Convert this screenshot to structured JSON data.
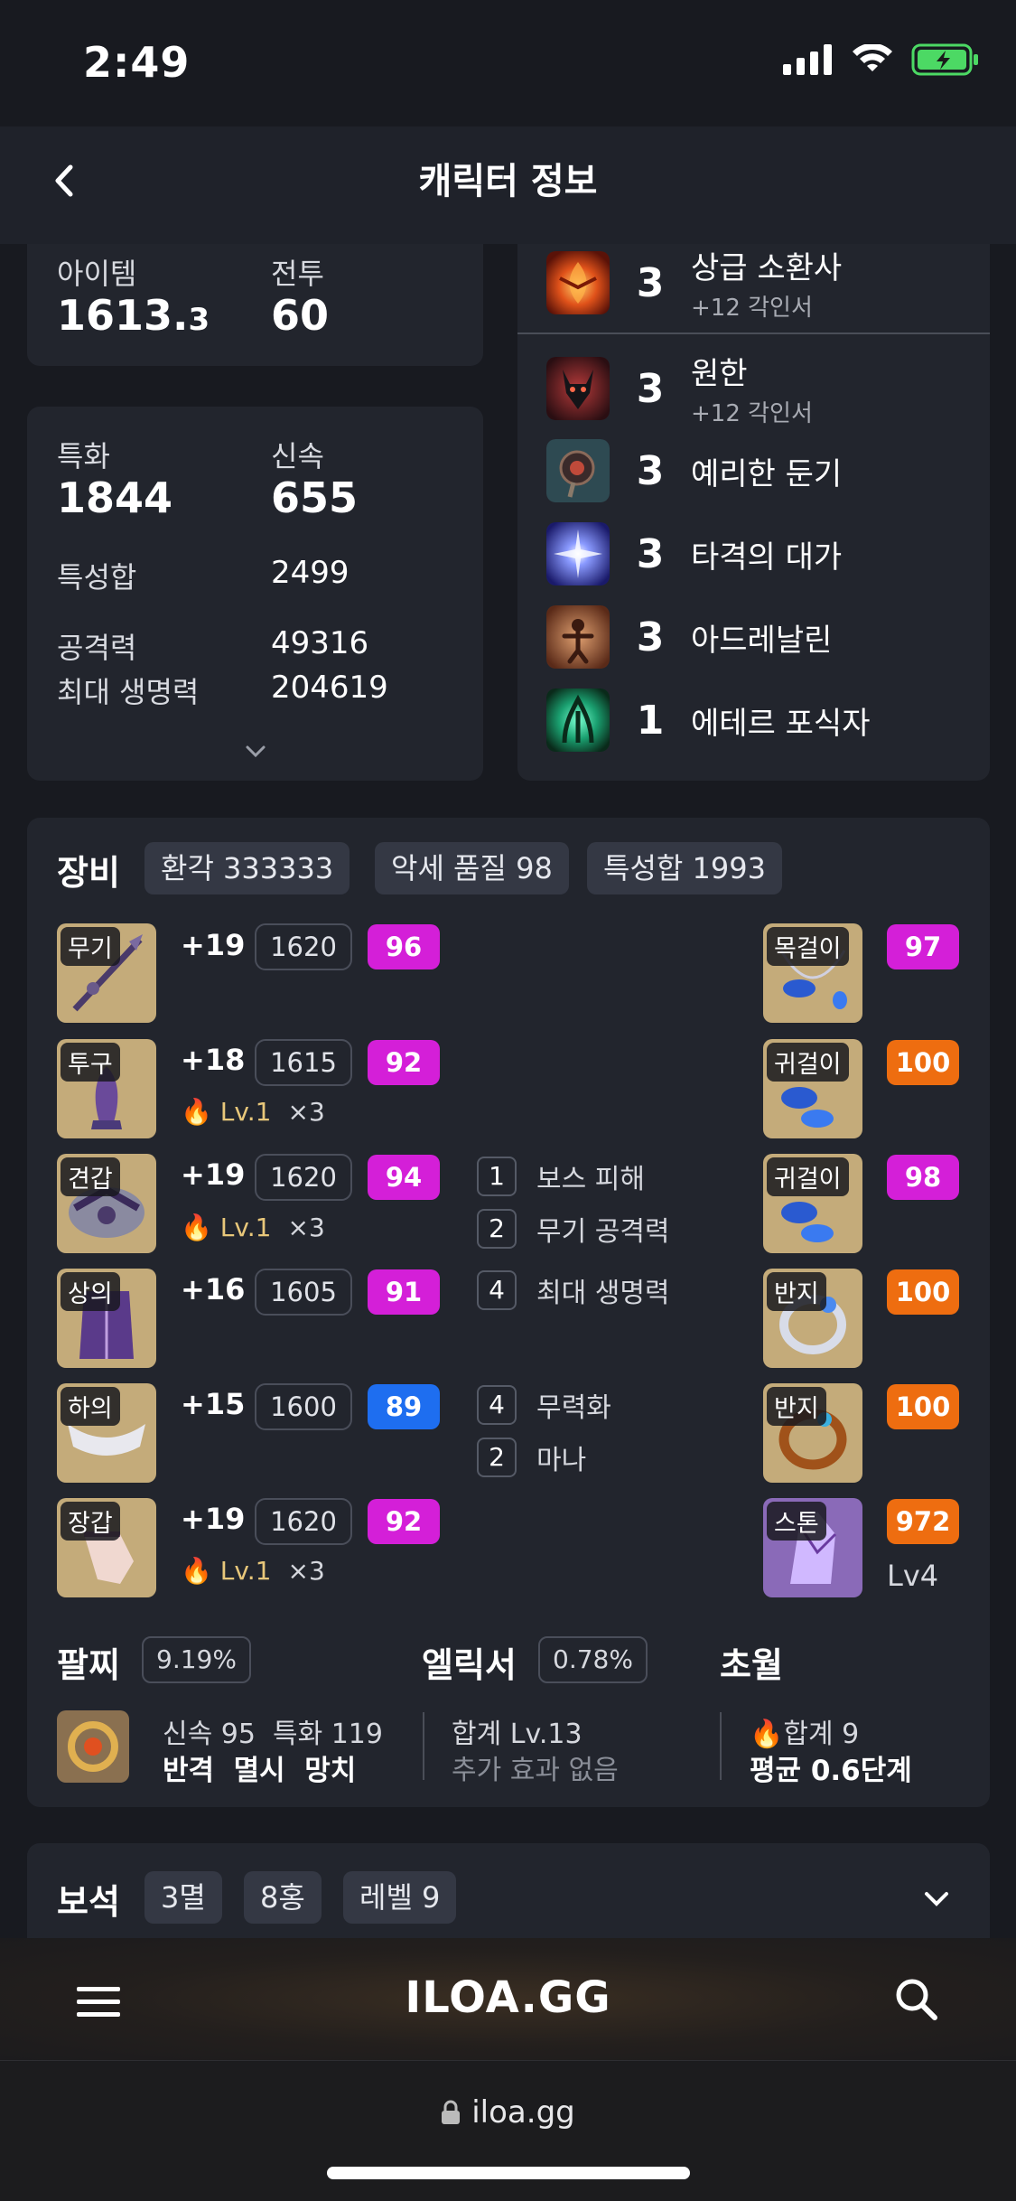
{
  "status": {
    "time": "2:49"
  },
  "header": {
    "title": "캐릭터 정보"
  },
  "stats_top": {
    "item_label": "아이템",
    "item_value": "1613.",
    "item_value_small": "3",
    "combat_label": "전투",
    "combat_value": "60"
  },
  "stats_main": {
    "crit_label": "특화",
    "crit_value": "1844",
    "swift_label": "신속",
    "swift_value": "655",
    "total_label": "특성합",
    "total_value": "2499",
    "atk_label": "공격력",
    "atk_value": "49316",
    "hp_label": "최대 생명력",
    "hp_value": "204619"
  },
  "engravings": [
    {
      "level": "3",
      "name": "상급 소환사",
      "sub": "+12 각인서",
      "icon": "phoenix-icon"
    },
    {
      "level": "3",
      "name": "원한",
      "sub": "+12 각인서",
      "icon": "demon-icon"
    },
    {
      "level": "3",
      "name": "예리한 둔기",
      "sub": "",
      "icon": "mace-icon"
    },
    {
      "level": "3",
      "name": "타격의 대가",
      "sub": "",
      "icon": "lightning-icon"
    },
    {
      "level": "3",
      "name": "아드레날린",
      "sub": "",
      "icon": "adrenaline-icon"
    },
    {
      "level": "1",
      "name": "에테르 포식자",
      "sub": "",
      "icon": "ether-icon"
    }
  ],
  "equipment": {
    "title": "장비",
    "chips": [
      "환각 333333",
      "악세 품질 98",
      "특성합 1993"
    ],
    "left": [
      {
        "slot": "무기",
        "plus": "+19",
        "ilvl": "1620",
        "quality": "96",
        "qclass": "q-mag",
        "lv": "",
        "x": ""
      },
      {
        "slot": "투구",
        "plus": "+18",
        "ilvl": "1615",
        "quality": "92",
        "qclass": "q-mag",
        "lv": "Lv.1",
        "x": "×3"
      },
      {
        "slot": "견갑",
        "plus": "+19",
        "ilvl": "1620",
        "quality": "94",
        "qclass": "q-mag",
        "lv": "Lv.1",
        "x": "×3"
      },
      {
        "slot": "상의",
        "plus": "+16",
        "ilvl": "1605",
        "quality": "91",
        "qclass": "q-mag",
        "lv": "",
        "x": ""
      },
      {
        "slot": "하의",
        "plus": "+15",
        "ilvl": "1600",
        "quality": "89",
        "qclass": "q-blu",
        "lv": "",
        "x": ""
      },
      {
        "slot": "장갑",
        "plus": "+19",
        "ilvl": "1620",
        "quality": "92",
        "qclass": "q-mag",
        "lv": "Lv.1",
        "x": "×3"
      }
    ],
    "effects": [
      {
        "num": "1",
        "text": "보스 피해"
      },
      {
        "num": "2",
        "text": "무기 공격력"
      },
      {
        "num": "4",
        "text": "최대 생명력"
      },
      {
        "num": "4",
        "text": "무력화"
      },
      {
        "num": "2",
        "text": "마나"
      }
    ],
    "right": [
      {
        "slot": "목걸이",
        "quality": "97",
        "qclass": "q-mag"
      },
      {
        "slot": "귀걸이",
        "quality": "100",
        "qclass": "q-org"
      },
      {
        "slot": "귀걸이",
        "quality": "98",
        "qclass": "q-mag"
      },
      {
        "slot": "반지",
        "quality": "100",
        "qclass": "q-org"
      },
      {
        "slot": "반지",
        "quality": "100",
        "qclass": "q-org"
      },
      {
        "slot": "스톤",
        "quality": "972",
        "qclass": "q-org"
      }
    ],
    "stone_level": "Lv4"
  },
  "bracelet": {
    "title": "팔찌",
    "pct": "9.19%",
    "line1": "신속 95  특화 119",
    "line2": "반격  멸시  망치"
  },
  "elixir": {
    "title": "엘릭서",
    "pct": "0.78%",
    "line1": "합계 Lv.13",
    "line2": "추가 효과 없음"
  },
  "transcend": {
    "title": "초월",
    "line1": "합계 9",
    "line2": "평균 0.6단계"
  },
  "gems": {
    "title": "보석",
    "chips": [
      "3멸",
      "8홍",
      "레벨 9"
    ]
  },
  "nav": {
    "logo": "ILOA.GG"
  },
  "browser": {
    "url": "iloa.gg"
  },
  "colors": {
    "magenta": "#d41fd8",
    "orange": "#ee6d10",
    "blue": "#1e6ef0"
  }
}
